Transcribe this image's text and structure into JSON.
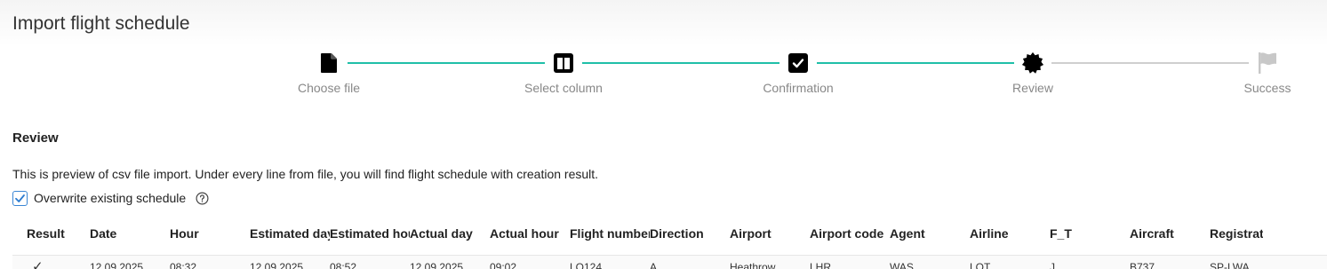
{
  "page": {
    "title": "Import flight schedule"
  },
  "stepper": {
    "steps": [
      {
        "label": "Choose file",
        "icon": "file-icon",
        "state": "done"
      },
      {
        "label": "Select column",
        "icon": "columns-icon",
        "state": "done"
      },
      {
        "label": "Confirmation",
        "icon": "check-square-icon",
        "state": "done"
      },
      {
        "label": "Review",
        "icon": "badge-icon",
        "state": "current"
      },
      {
        "label": "Success",
        "icon": "flag-icon",
        "state": "todo"
      }
    ],
    "colors": {
      "active_line": "#1fbfa8",
      "inactive_line": "#cfcfcf",
      "active_icon": "#000000",
      "inactive_icon": "#c8c8c8"
    }
  },
  "review": {
    "heading": "Review",
    "description": "This is preview of csv file import. Under every line from file, you will find flight schedule with creation result.",
    "overwrite": {
      "label": "Overwrite existing schedule",
      "checked": true
    }
  },
  "table": {
    "columns": [
      "Result",
      "Date",
      "Hour",
      "Estimated day",
      "Estimated hour",
      "Actual day",
      "Actual hour",
      "Flight number",
      "Direction",
      "Airport",
      "Airport code",
      "Agent",
      "Airline",
      "F_T",
      "Aircraft",
      "Registration"
    ],
    "rows": [
      {
        "result": "✓",
        "cells": [
          "12.09.2025",
          "08:32",
          "12.09.2025",
          "08:52",
          "12.09.2025",
          "09:02",
          "LO124",
          "A",
          "Heathrow",
          "LHR",
          "WAS",
          "LOT",
          "J",
          "B737",
          "SP-LWA"
        ]
      }
    ]
  }
}
